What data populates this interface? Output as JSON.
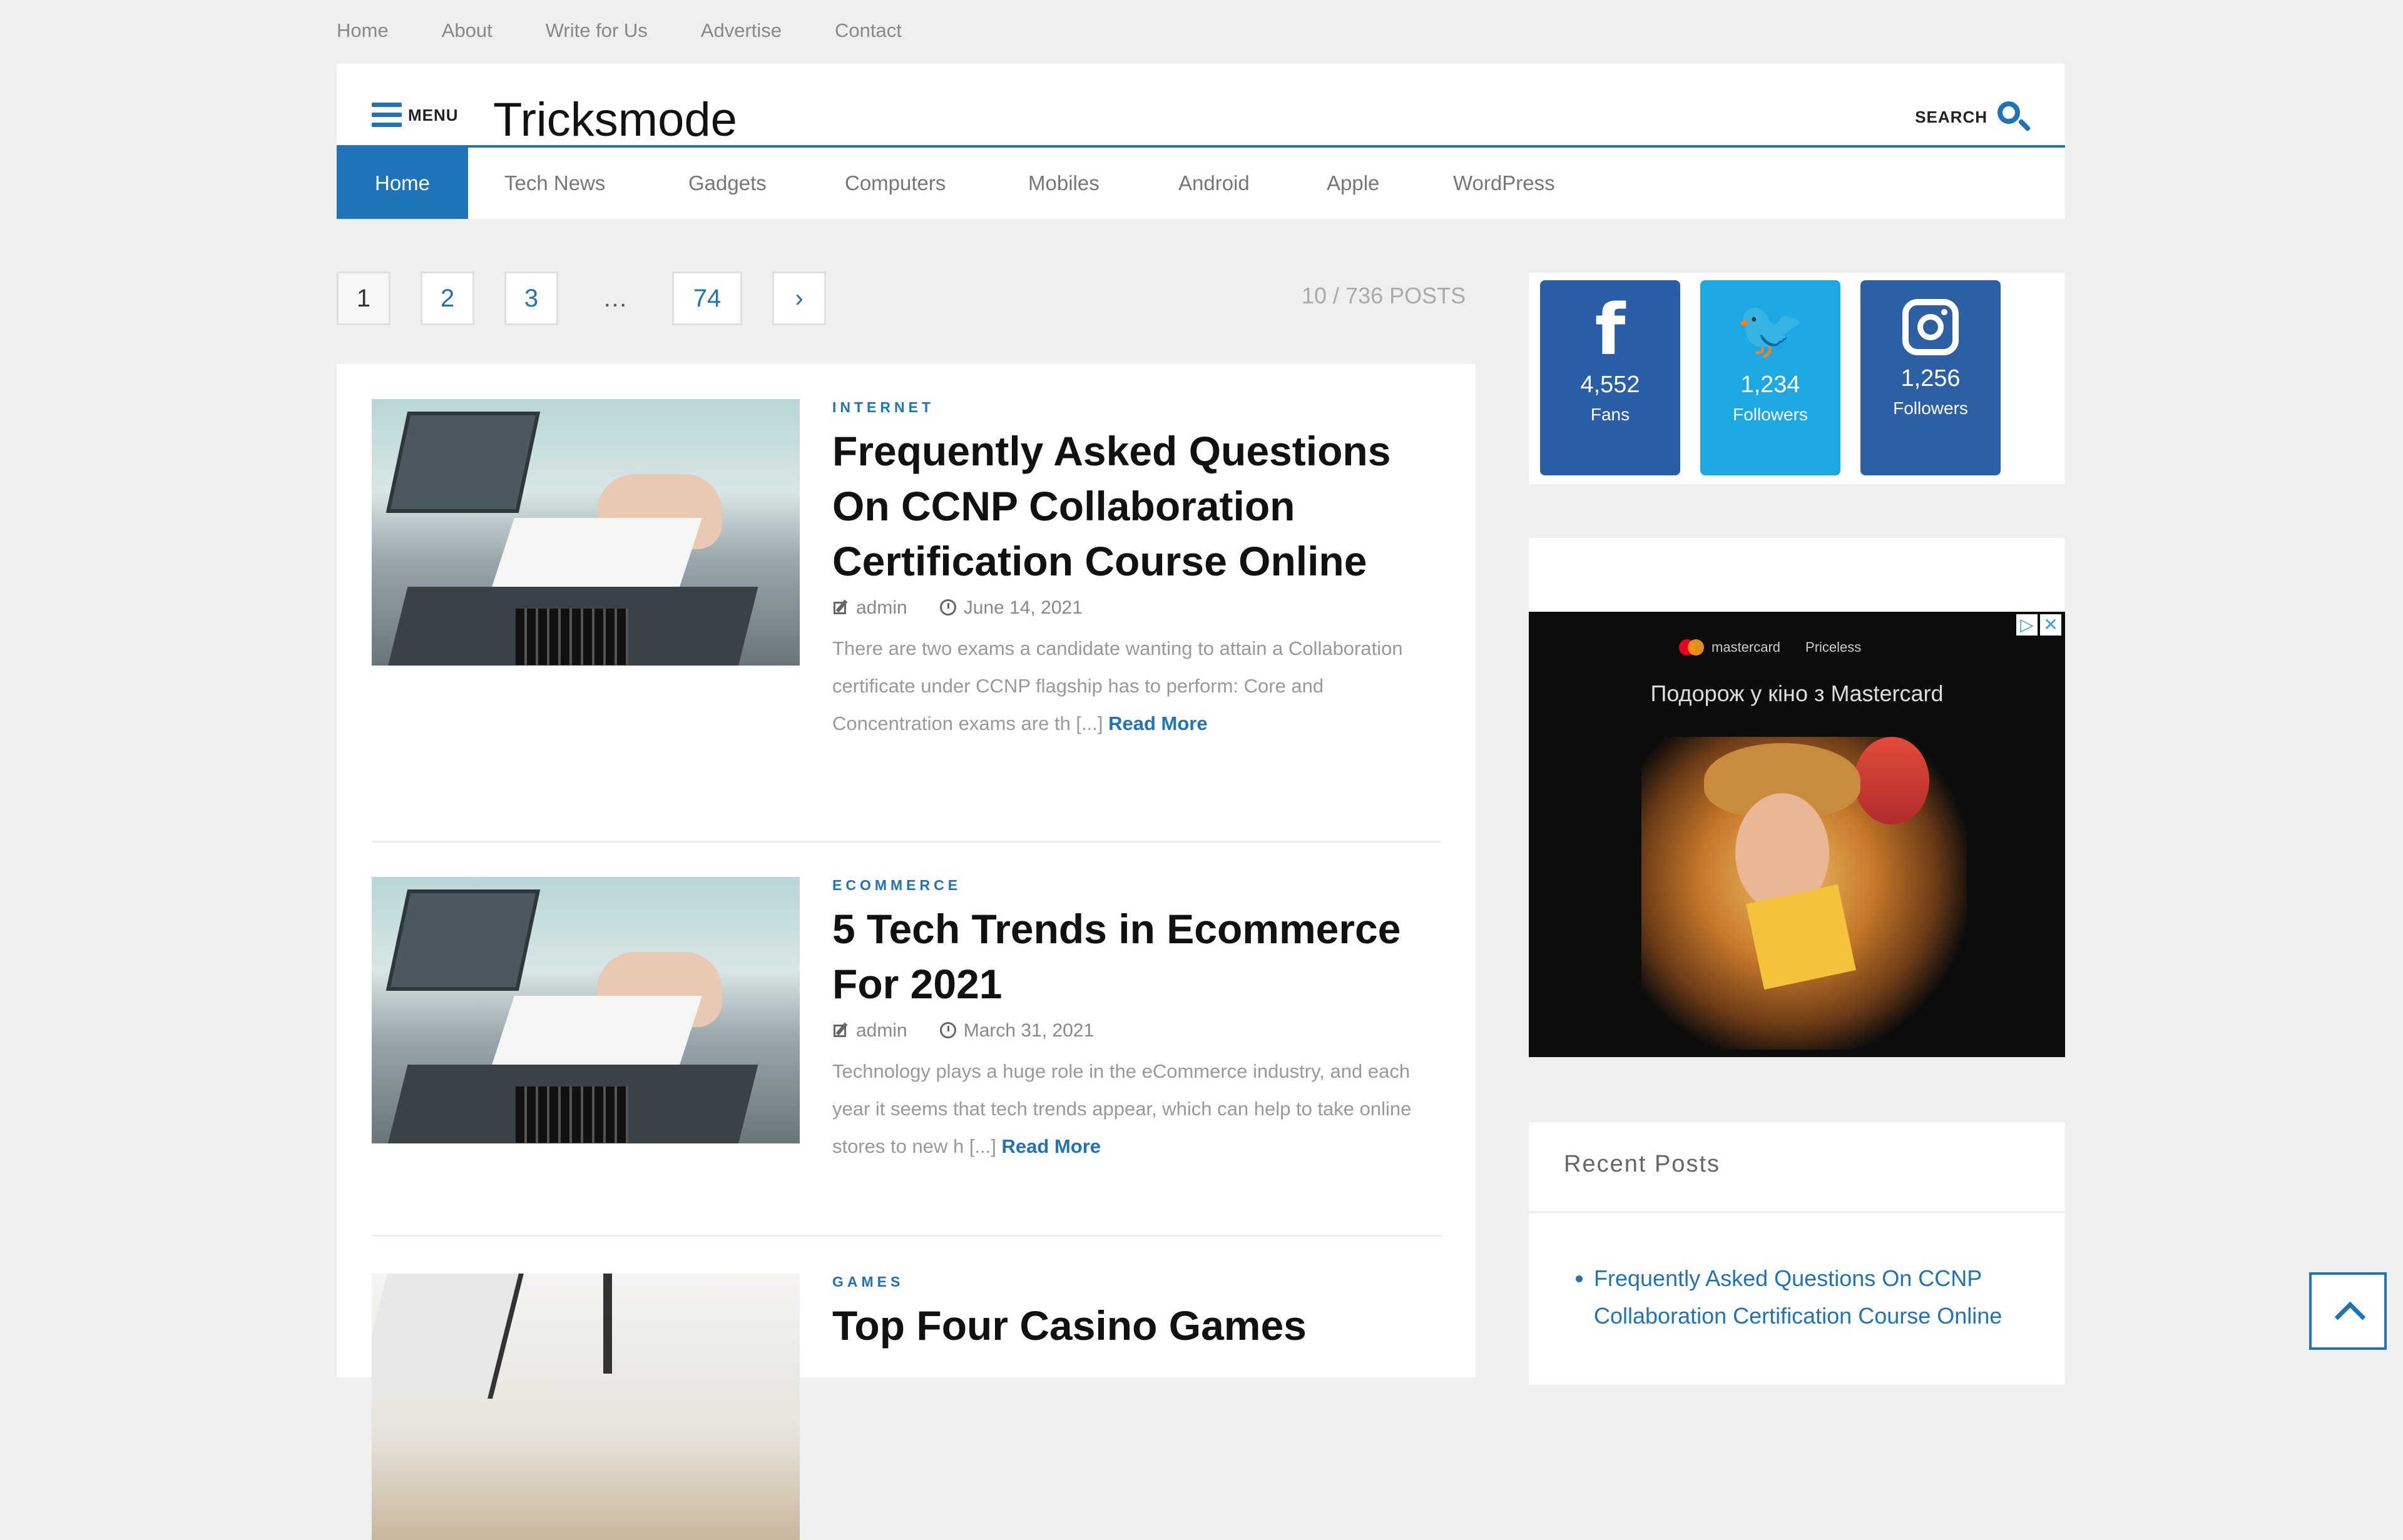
{
  "top_links": [
    "Home",
    "About",
    "Write for Us",
    "Advertise",
    "Contact"
  ],
  "header": {
    "menu_label": "MENU",
    "brand": "Tricksmode",
    "search_label": "SEARCH"
  },
  "nav": {
    "items": [
      "Home",
      "Tech News",
      "Gadgets",
      "Computers",
      "Mobiles",
      "Android",
      "Apple",
      "WordPress"
    ],
    "active": "Home"
  },
  "pagination": {
    "pages": [
      "1",
      "2",
      "3"
    ],
    "dots": "…",
    "last": "74",
    "next": "›",
    "count_label": "10 / 736 POSTS"
  },
  "posts": [
    {
      "category": "INTERNET",
      "title": "Frequently Asked Questions On CCNP Collaboration Certification Course Online",
      "author": "admin",
      "date": "June 14, 2021",
      "excerpt": "There are two exams a candidate wanting to attain a Collaboration certificate under CCNP flagship has to perform: Core and Concentration exams are th [...]",
      "read_more": "Read More"
    },
    {
      "category": "ECOMMERCE",
      "title": "5 Tech Trends in Ecommerce For 2021",
      "author": "admin",
      "date": "March 31, 2021",
      "excerpt": "Technology plays a huge role in the eCommerce industry, and each year it seems that tech trends appear, which can help to take online stores to new h [...]",
      "read_more": "Read More"
    },
    {
      "category": "GAMES",
      "title": "Top Four Casino Games"
    }
  ],
  "social": {
    "facebook": {
      "icon": "facebook-icon",
      "glyph": "f",
      "count": "4,552",
      "unit": "Fans",
      "color": "#2a5fa8"
    },
    "twitter": {
      "icon": "twitter-icon",
      "glyph": "🐦",
      "count": "1,234",
      "unit": "Followers",
      "color": "#1ca8e3"
    },
    "instagram": {
      "icon": "instagram-icon",
      "count": "1,256",
      "unit": "Followers",
      "color": "#2c5fa3"
    }
  },
  "ad": {
    "brand_1": "mastercard",
    "brand_2": "Priceless",
    "tagline": "Подорож у кіно з Mastercard"
  },
  "recent_posts": {
    "title": "Recent Posts",
    "items": [
      "Frequently Asked Questions On CCNP Collaboration Certification Course Online"
    ]
  },
  "colors": {
    "accent": "#1f73b7",
    "background": "#efefef"
  }
}
